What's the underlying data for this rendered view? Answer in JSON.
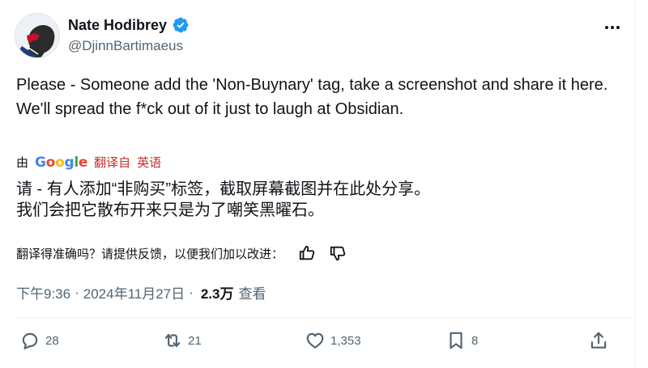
{
  "author": {
    "name": "Nate Hodibrey",
    "handle": "@DjinnBartimaeus"
  },
  "tweet": {
    "line1": "Please - Someone add the 'Non-Buynary' tag, take a screenshot and share it here.",
    "line2": "We'll spread the f*ck out of it just to laugh at Obsidian."
  },
  "translation": {
    "by_label": "由",
    "provider": "Google",
    "action_label": "翻译自",
    "language": "英语",
    "line1": "请 - 有人添加“非购买”标签，截取屏幕截图并在此处分享。",
    "line2": "我们会把它散布开来只是为了嘲笑黑曜石。"
  },
  "feedback": {
    "prompt": "翻译得准确吗？请提供反馈，以便我们加以改进："
  },
  "meta": {
    "time": "下午9:36",
    "dot1": "·",
    "date": "2024年11月27日",
    "dot2": "·",
    "views_count": "2.3万",
    "views_label": "查看"
  },
  "actions": {
    "replies": "28",
    "reposts": "21",
    "likes": "1,353",
    "bookmarks": "8"
  },
  "colors": {
    "verified": "#1d9bf0",
    "secondary_text": "#536471",
    "translate_link": "#c4302b"
  },
  "icons": [
    "verified-badge-icon",
    "more-icon",
    "thumbs-up-icon",
    "thumbs-down-icon",
    "reply-icon",
    "repost-icon",
    "like-icon",
    "bookmark-icon",
    "share-icon"
  ]
}
